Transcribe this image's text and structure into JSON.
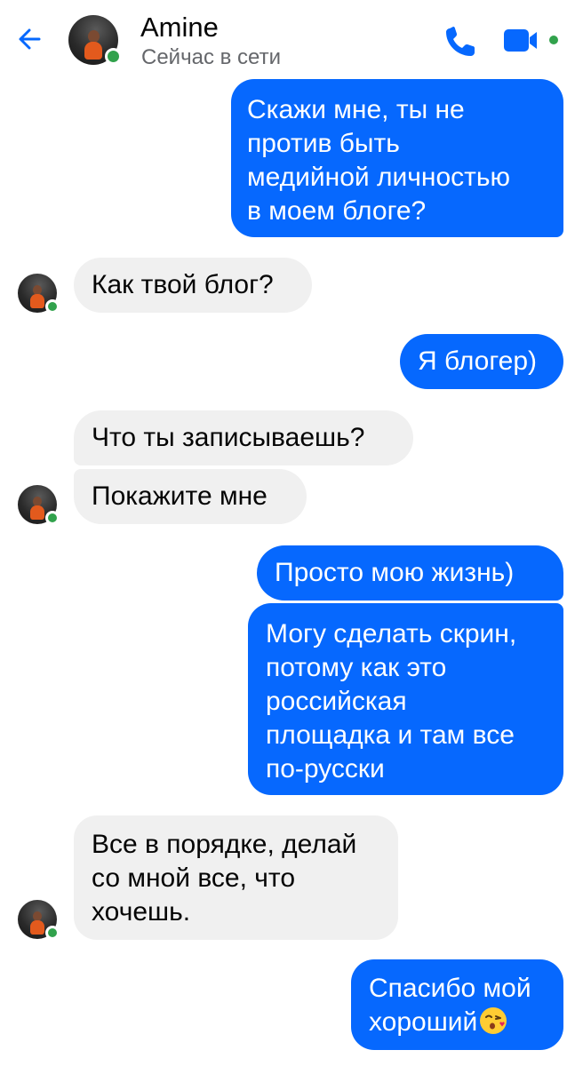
{
  "header": {
    "contact_name": "Amine",
    "contact_status": "Сейчас в сети",
    "back_icon": "arrow-left-icon",
    "call_icon": "phone-icon",
    "video_icon": "video-camera-icon",
    "accent_color": "#0668fe",
    "online_color": "#31a24c"
  },
  "messages": [
    {
      "from": "me",
      "text": "Скажи мне, ты не\nпротив быть\nмедийной личностью\nв моем блоге?"
    },
    {
      "from": "contact",
      "text": "Как твой блог?"
    },
    {
      "from": "me",
      "text": "Я блогер)"
    },
    {
      "from": "contact",
      "text": "Что ты записываешь?"
    },
    {
      "from": "contact",
      "text": "Покажите мне"
    },
    {
      "from": "me",
      "text": "Просто мою жизнь)"
    },
    {
      "from": "me",
      "text": "Могу сделать скрин,\nпотому как это\nроссийская\nплощадка и там все\nпо-русски"
    },
    {
      "from": "contact",
      "text": "Все в порядке, делай\nсо мной все, что\nхочешь."
    },
    {
      "from": "me",
      "text": "Спасибо мой\nхороший",
      "emoji": "kissing-face-icon"
    }
  ],
  "colors": {
    "outgoing_bubble": "#0668fe",
    "incoming_bubble": "#f0f0f0",
    "status_text": "#65676b"
  }
}
